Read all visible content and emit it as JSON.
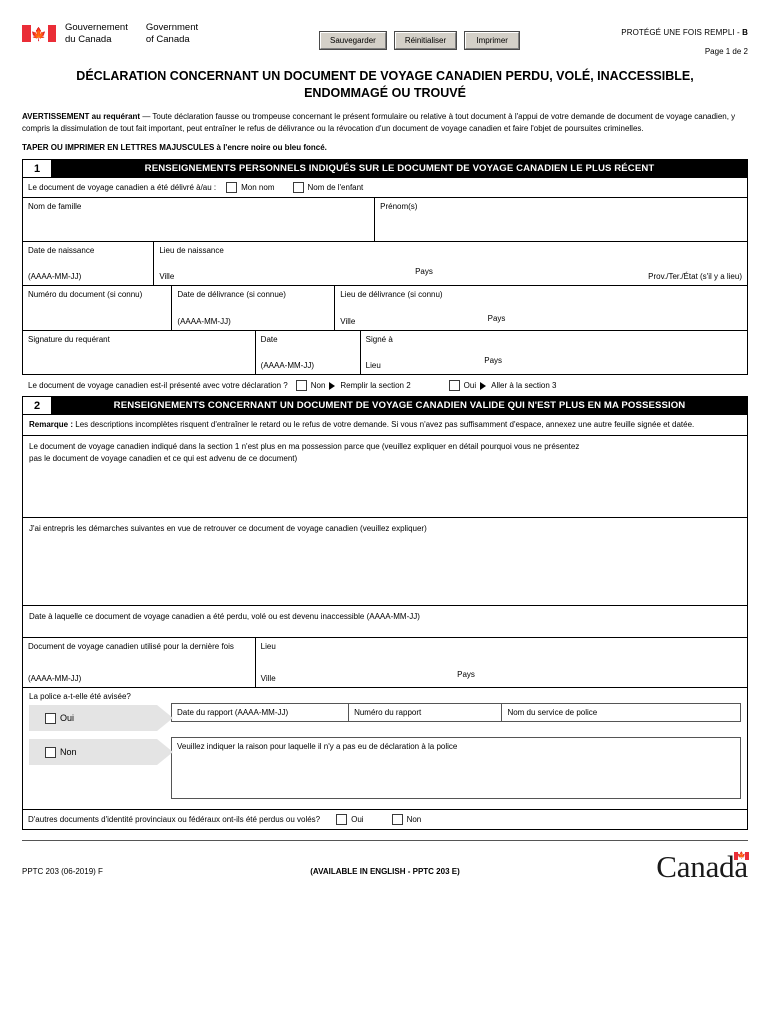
{
  "header": {
    "flag_icon": "canada-flag-icon",
    "gov_fr_line1": "Gouvernement",
    "gov_fr_line2": "du Canada",
    "gov_en_line1": "Government",
    "gov_en_line2": "of Canada",
    "buttons": [
      {
        "label": "Sauvegarder",
        "name": "save-button"
      },
      {
        "label": "Réinitialiser",
        "name": "reset-button"
      },
      {
        "label": "Imprimer",
        "name": "print-button"
      }
    ],
    "protected_prefix": "PROTÉGÉ UNE FOIS REMPLI - ",
    "protected_level": "B",
    "page_number": "Page 1 de 2"
  },
  "title": "DÉCLARATION CONCERNANT UN DOCUMENT DE VOYAGE CANADIEN PERDU, VOLÉ, INACCESSIBLE, ENDOMMAGÉ OU TROUVÉ",
  "warning": {
    "bold": "AVERTISSEMENT au requérant",
    "text": " — Toute déclaration fausse ou trompeuse concernant le présent formulaire ou relative à tout document à l'appui de votre demande de document de voyage canadien, y compris la dissimulation de tout fait important, peut entraîner le refus de délivrance ou la révocation d'un document de voyage canadien et faire l'objet de poursuites criminelles."
  },
  "instruction": {
    "bold": "TAPER OU IMPRIMER EN LETTRES MAJUSCULES",
    "rest": " à l'encre noire ou bleu foncé."
  },
  "section1": {
    "number": "1",
    "title": "RENSEIGNEMENTS PERSONNELS INDIQUÉS SUR LE DOCUMENT DE VOYAGE CANADIEN LE PLUS RÉCENT",
    "issued_to_label": "Le document de voyage canadien a été délivré à/au :",
    "issued_to_options": [
      "Mon nom",
      "Nom de l'enfant"
    ],
    "surname_label": "Nom de famille",
    "given_names_label": "Prénom(s)",
    "birth_date_label": "Date de naissance",
    "birth_date_format": "(AAAA-MM-JJ)",
    "birth_place_label": "Lieu de naissance",
    "city_label": "Ville",
    "country_label": "Pays",
    "prov_label": "Prov./Ter./État (s'il y a lieu)",
    "doc_number_label": "Numéro du document (si connu)",
    "issue_date_label": "Date de délivrance (si connue)",
    "issue_date_format": "(AAAA-MM-JJ)",
    "issue_place_label": "Lieu de délivrance (si connu)",
    "issue_city_label": "Ville",
    "issue_country_label": "Pays",
    "signature_label": "Signature du requérant",
    "sig_date_label": "Date",
    "sig_date_format": "(AAAA-MM-JJ)",
    "signed_at_label": "Signé à",
    "signed_place_label": "Lieu",
    "signed_country_label": "Pays",
    "presented_question": "Le document de voyage canadien est-il présenté avec votre déclaration ?",
    "presented_no": "Non",
    "presented_no_action": "Remplir la section 2",
    "presented_yes": "Oui",
    "presented_yes_action": "Aller à la section 3"
  },
  "section2": {
    "number": "2",
    "title": "RENSEIGNEMENTS CONCERNANT UN DOCUMENT DE VOYAGE CANADIEN VALIDE QUI N'EST PLUS EN MA POSSESSION",
    "note_bold": "Remarque :",
    "note_text": " Les descriptions incomplètes risquent d'entraîner le retard ou le refus de votre demande. Si vous n'avez pas suffisamment d'espace, annexez une autre feuille signée et datée.",
    "explain_line1": "Le document de voyage canadien indiqué dans la section 1 n'est plus en ma possession parce que (veuillez expliquer en détail pourquoi vous ne présentez",
    "explain_line2": "pas le document de voyage canadien et ce qui est advenu de ce document)",
    "steps_label": "J'ai entrepris les démarches suivantes en vue de retrouver ce document de voyage canadien (veuillez expliquer)",
    "lost_date_label": "Date à laquelle ce document de voyage canadien a été perdu, volé ou est devenu inaccessible (AAAA-MM-JJ)",
    "last_used_label": "Document de voyage canadien utilisé pour la dernière fois",
    "last_used_format": "(AAAA-MM-JJ)",
    "last_place_label": "Lieu",
    "last_city_label": "Ville",
    "last_country_label": "Pays",
    "police_question": "La police a-t-elle été avisée?",
    "police_yes": "Oui",
    "police_no": "Non",
    "report_date_label": "Date du rapport (AAAA-MM-JJ)",
    "report_number_label": "Numéro du rapport",
    "police_service_label": "Nom du service de police",
    "no_report_reason_label": "Veuillez indiquer la raison pour laquelle il n'y a pas eu de déclaration à la police",
    "other_docs_question": "D'autres documents d'identité provinciaux ou fédéraux ont-ils été perdus ou volés?",
    "other_docs_yes": "Oui",
    "other_docs_no": "Non"
  },
  "footer": {
    "form_code": "PPTC 203 (06-2019) F",
    "available_in": "(AVAILABLE IN ENGLISH - PPTC 203 E)",
    "wordmark": "Canada",
    "wordmark_flag_icon": "canada-flag-icon"
  },
  "colors": {
    "flag_red": "#EA2D37",
    "section_header_bg": "#000000",
    "banner_gray": "#e4e4e4",
    "button_face": "#d4d0c8"
  }
}
